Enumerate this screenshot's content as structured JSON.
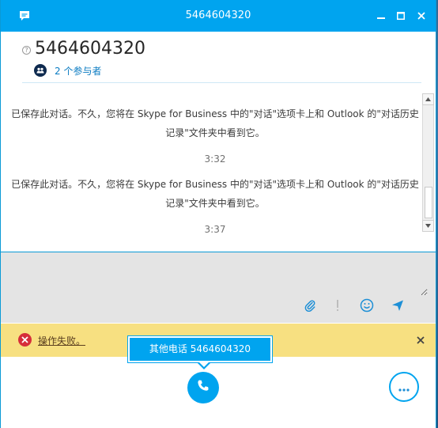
{
  "window": {
    "title": "5464604320"
  },
  "header": {
    "conversation_title": "5464604320",
    "participants_label": "2 个参与者"
  },
  "messages": [
    {
      "text": "已保存此对话。不久，您将在 Skype for Business 中的\"对话\"选项卡上和 Outlook 的\"对话历史记录\"文件夹中看到它。",
      "time": "3:32"
    },
    {
      "text": "已保存此对话。不久，您将在 Skype for Business 中的\"对话\"选项卡上和 Outlook 的\"对话历史记录\"文件夹中看到它。",
      "time": "3:37"
    }
  ],
  "error": {
    "text": "操作失败。"
  },
  "popup": {
    "label": "其他电话 5464604320"
  },
  "icons": {
    "app": "skype-chat-icon",
    "help": "question-icon",
    "participants": "people-icon",
    "attach": "paperclip-icon",
    "important": "exclamation-icon",
    "emoji": "smiley-icon",
    "send": "send-arrow-icon",
    "error": "error-x-icon",
    "call": "phone-icon",
    "more": "ellipsis-icon"
  },
  "colors": {
    "accent": "#00a4ef",
    "error_bar": "#f7e081",
    "error_icon": "#d62e3a",
    "link": "#0a7bc2"
  }
}
